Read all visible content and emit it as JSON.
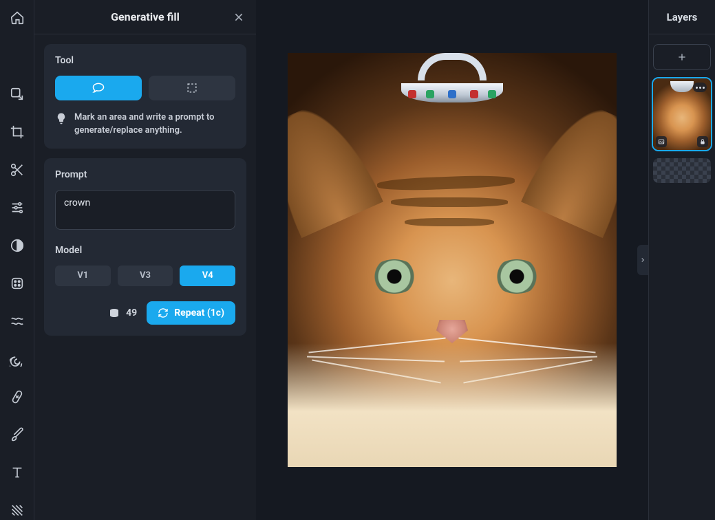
{
  "panel": {
    "title": "Generative fill",
    "tool_label": "Tool",
    "tip": "Mark an area and write a prompt to generate/replace anything.",
    "prompt_label": "Prompt",
    "prompt_value": "crown",
    "model_label": "Model",
    "models": [
      "V1",
      "V3",
      "V4"
    ],
    "active_model_index": 2,
    "credits": "49",
    "repeat_label": "Repeat (1c)"
  },
  "layers": {
    "title": "Layers"
  },
  "colors": {
    "accent": "#1aa9ee"
  }
}
